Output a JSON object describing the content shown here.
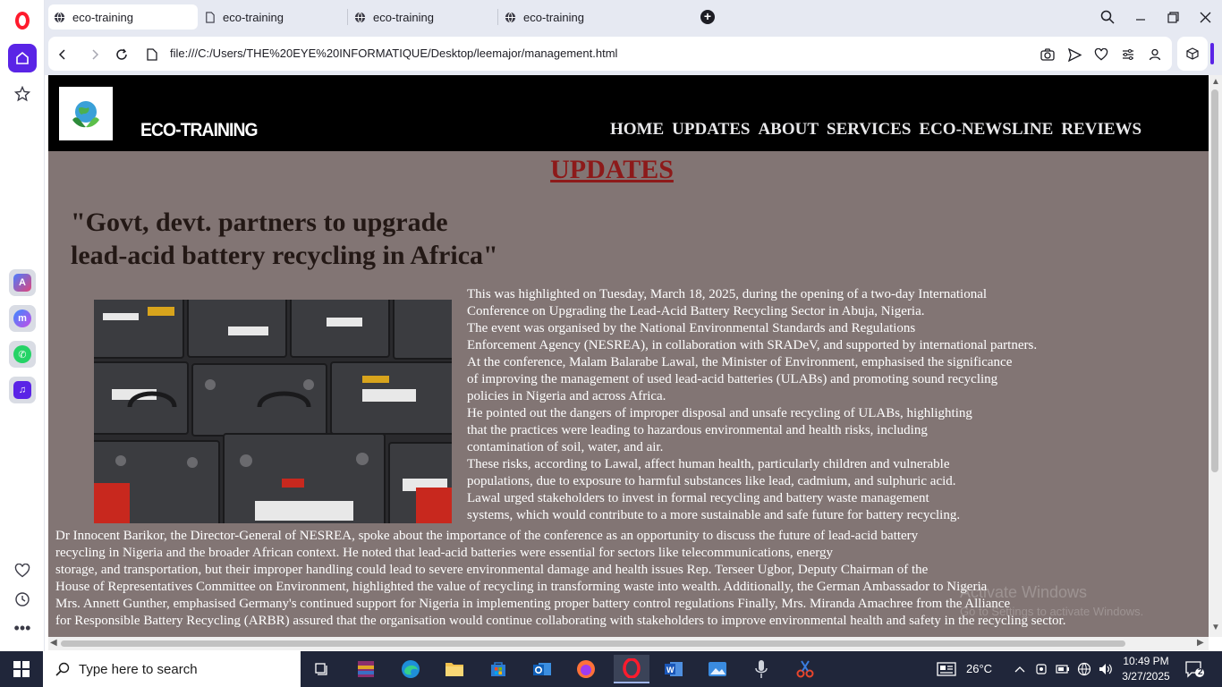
{
  "browser": {
    "tabs": [
      {
        "label": "eco-training",
        "active": true
      },
      {
        "label": "eco-training",
        "active": false
      },
      {
        "label": "eco-training",
        "active": false
      },
      {
        "label": "eco-training",
        "active": false
      }
    ],
    "url": "file:///C:/Users/THE%20EYE%20INFORMATIQUE/Desktop/leemajor/management.html",
    "accent_color": "#5a24e6",
    "logo_color": "#ff1b2d"
  },
  "site": {
    "title": "ECO-TRAINING",
    "nav": [
      "HOME",
      "UPDATES",
      "ABOUT",
      "SERVICES",
      "ECO-NEWSLINE",
      "REVIEWS"
    ],
    "header_bg": "#000000",
    "page_bg": "#827574"
  },
  "page": {
    "heading": "UPDATES",
    "heading_color": "#8d1a1a",
    "article_title": "\"Govt, devt. partners to upgrade\nlead-acid battery recycling in Africa\"",
    "side_lines": [
      "This was highlighted on Tuesday, March 18, 2025, during the opening of a two-day International",
      "Conference on Upgrading the Lead-Acid Battery Recycling Sector in Abuja, Nigeria.",
      "The event was organised by the National Environmental Standards and Regulations",
      "Enforcement Agency (NESREA), in collaboration with SRADeV, and supported by international partners.",
      "At the conference, Malam Balarabe Lawal, the Minister of Environment, emphasised the significance",
      "of improving the management of used lead-acid batteries (ULABs) and promoting sound recycling",
      "policies in Nigeria and across Africa.",
      "He pointed out the dangers of improper disposal and unsafe recycling of ULABs, highlighting",
      "that the practices were leading to hazardous environmental and health risks, including",
      "contamination of soil, water, and air.",
      "These risks, according to Lawal, affect human health, particularly children and vulnerable",
      "populations, due to exposure to harmful substances like lead, cadmium, and sulphuric acid.",
      "Lawal urged stakeholders to invest in formal recycling and battery waste management",
      "systems, which would contribute to a more sustainable and safe future for battery recycling."
    ],
    "body_lines": [
      "Dr Innocent Barikor, the Director-General of NESREA, spoke about the importance of the conference as an opportunity to discuss the future of lead-acid battery",
      "recycling in Nigeria and the broader African context. He noted that lead-acid batteries were essential for sectors like telecommunications, energy",
      "storage, and transportation, but their improper handling could lead to severe environmental damage and health issues Rep. Terseer Ugbor, Deputy Chairman of the",
      "House of Representatives Committee on Environment, highlighted the value of recycling in transforming waste into wealth. Additionally, the German Ambassador to Nigeria",
      "Mrs. Annett Gunther, emphasised Germany's continued support for Nigeria in implementing proper battery control regulations Finally, Mrs. Miranda Amachree from the Alliance",
      "for Responsible Battery Recycling (ARBR) assured that the organisation would continue collaborating with stakeholders to improve environmental health and safety in the recycling sector."
    ],
    "watermark_line1": "Activate Windows",
    "watermark_line2": "Go to Settings to activate Windows."
  },
  "taskbar": {
    "search_placeholder": "Type here to search",
    "weather": "26°C",
    "time": "10:49 PM",
    "date": "3/27/2025",
    "notification_count": "2",
    "bg": "#20263a"
  }
}
